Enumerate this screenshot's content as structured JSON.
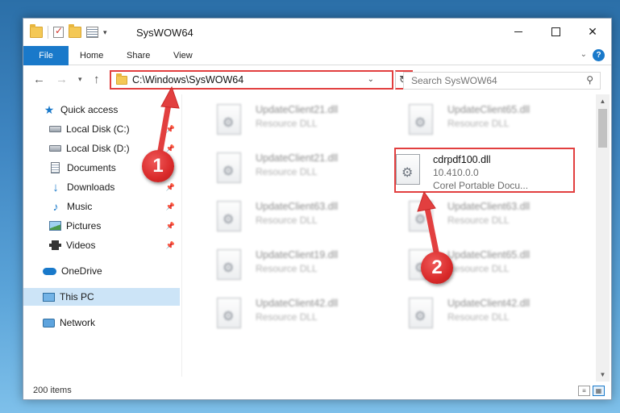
{
  "window": {
    "title": "SysWOW64"
  },
  "ribbon": {
    "tabs": [
      "File",
      "Home",
      "Share",
      "View"
    ],
    "help_label": "?"
  },
  "address": {
    "path": "C:\\Windows\\SysWOW64",
    "search_placeholder": "Search SysWOW64"
  },
  "nav_pane": {
    "items": [
      {
        "label": "Quick access",
        "icon": "star-icon",
        "pinned": false
      },
      {
        "label": "Local Disk (C:)",
        "icon": "drive-icon",
        "pinned": true
      },
      {
        "label": "Local Disk (D:)",
        "icon": "drive-icon",
        "pinned": true
      },
      {
        "label": "Documents",
        "icon": "documents-icon",
        "pinned": true
      },
      {
        "label": "Downloads",
        "icon": "download-icon",
        "pinned": true
      },
      {
        "label": "Music",
        "icon": "music-icon",
        "pinned": true
      },
      {
        "label": "Pictures",
        "icon": "pictures-icon",
        "pinned": true
      },
      {
        "label": "Videos",
        "icon": "videos-icon",
        "pinned": true
      },
      {
        "label": "OneDrive",
        "icon": "cloud-icon",
        "pinned": false
      },
      {
        "label": "This PC",
        "icon": "computer-icon",
        "pinned": false,
        "selected": true
      },
      {
        "label": "Network",
        "icon": "network-icon",
        "pinned": false
      }
    ]
  },
  "files": {
    "left_column": [
      {
        "name": "UpdateClient21.dll",
        "desc": "Resource DLL"
      },
      {
        "name": "UpdateClient21.dll",
        "desc": "Resource DLL"
      },
      {
        "name": "UpdateClient63.dll",
        "desc": "Resource DLL"
      },
      {
        "name": "UpdateClient19.dll",
        "desc": "Resource DLL"
      },
      {
        "name": "UpdateClient42.dll",
        "desc": "Resource DLL"
      }
    ],
    "right_column": [
      {
        "name": "UpdateClient65.dll",
        "desc": "Resource DLL"
      },
      {
        "name": "cdrpdf100.dll",
        "desc": "10.410.0.0",
        "desc2": "Corel Portable Docu...",
        "focus": true
      },
      {
        "name": "UpdateClient63.dll",
        "desc": "Resource DLL"
      },
      {
        "name": "UpdateClient65.dll",
        "desc": "Resource DLL"
      },
      {
        "name": "UpdateClient42.dll",
        "desc": "Resource DLL"
      }
    ]
  },
  "status": {
    "item_count": "200 items"
  },
  "annotations": {
    "step1": "1",
    "step2": "2",
    "color": "#e23f3f"
  }
}
